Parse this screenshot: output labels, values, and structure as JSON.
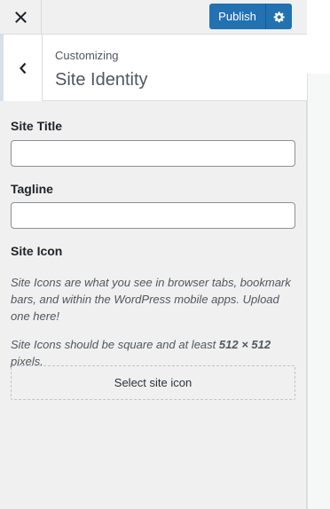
{
  "header": {
    "close_icon": "close-icon",
    "publish_label": "Publish",
    "settings_icon": "gear-icon"
  },
  "section": {
    "breadcrumb": "Customizing",
    "title": "Site Identity",
    "back_icon": "chevron-left-icon"
  },
  "form": {
    "site_title_label": "Site Title",
    "site_title_value": "",
    "tagline_label": "Tagline",
    "tagline_value": "",
    "site_icon_label": "Site Icon",
    "site_icon_desc_1": "Site Icons are what you see in browser tabs, bookmark bars, and within the WordPress mobile apps. Upload one here!",
    "site_icon_desc_2_pre": "Site Icons should be square and at least ",
    "site_icon_desc_2_size": "512 × 512",
    "site_icon_desc_2_post": " pixels.",
    "select_icon_label": "Select site icon"
  },
  "colors": {
    "accent": "#2271b1",
    "panel_bg": "#f0f0f1",
    "text": "#1d2327"
  }
}
